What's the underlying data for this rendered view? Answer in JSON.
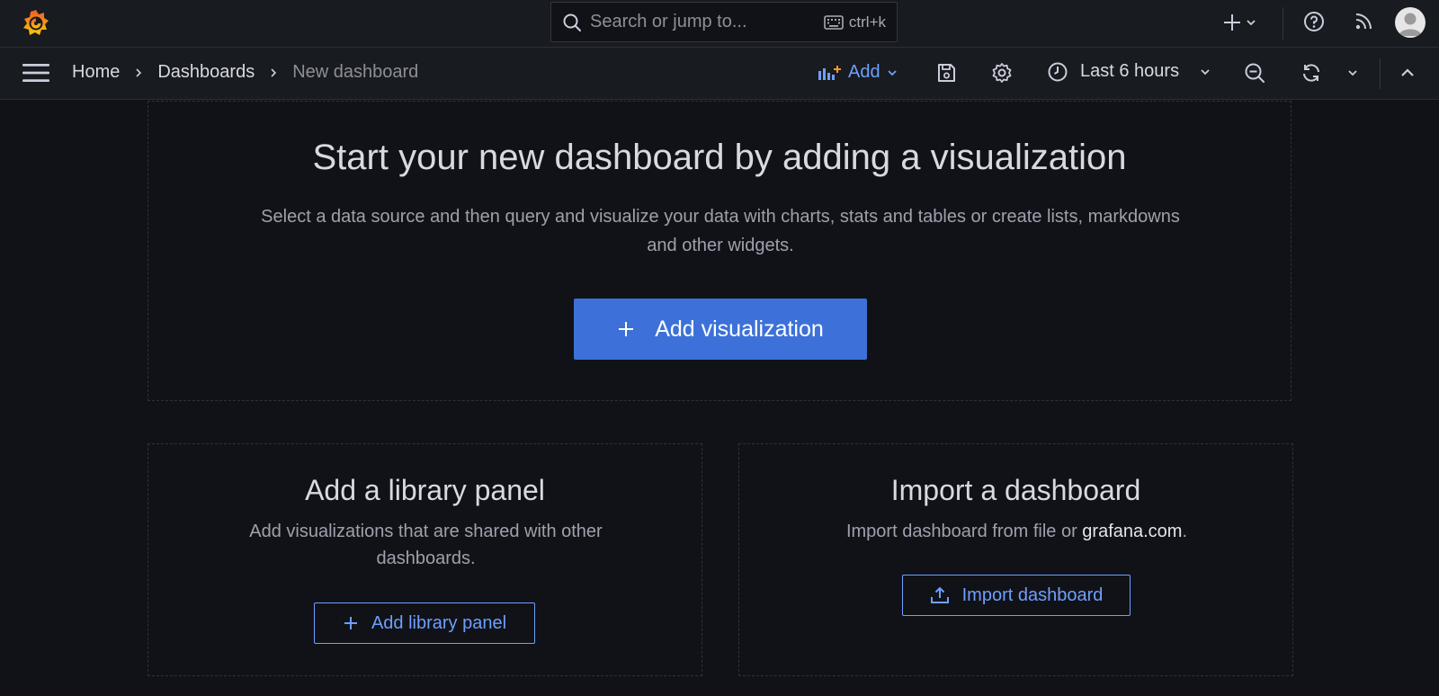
{
  "topbar": {
    "search_placeholder": "Search or jump to...",
    "search_shortcut": "ctrl+k"
  },
  "breadcrumb": {
    "items": [
      "Home",
      "Dashboards",
      "New dashboard"
    ]
  },
  "toolbar": {
    "add_label": "Add",
    "time_range": "Last 6 hours"
  },
  "hero": {
    "title": "Start your new dashboard by adding a visualization",
    "description": "Select a data source and then query and visualize your data with charts, stats and tables or create lists, markdowns and other widgets.",
    "button_label": "Add visualization"
  },
  "library_card": {
    "title": "Add a library panel",
    "description": "Add visualizations that are shared with other dashboards.",
    "button_label": "Add library panel"
  },
  "import_card": {
    "title": "Import a dashboard",
    "description_prefix": "Import dashboard from file or ",
    "description_link": "grafana.com",
    "description_suffix": ".",
    "button_label": "Import dashboard"
  },
  "colors": {
    "accent": "#3d71d9",
    "link": "#6e9fff",
    "background": "#111217",
    "bar": "#181b1f"
  },
  "icons": [
    "grafana-logo-icon",
    "search-icon",
    "keyboard-icon",
    "plus-icon",
    "chevron-down-icon",
    "help-icon",
    "rss-icon",
    "avatar",
    "menu-icon",
    "chevron-right-icon",
    "add-panel-icon",
    "save-icon",
    "gear-icon",
    "clock-icon",
    "zoom-out-icon",
    "refresh-icon",
    "chevron-up-icon",
    "upload-icon"
  ]
}
